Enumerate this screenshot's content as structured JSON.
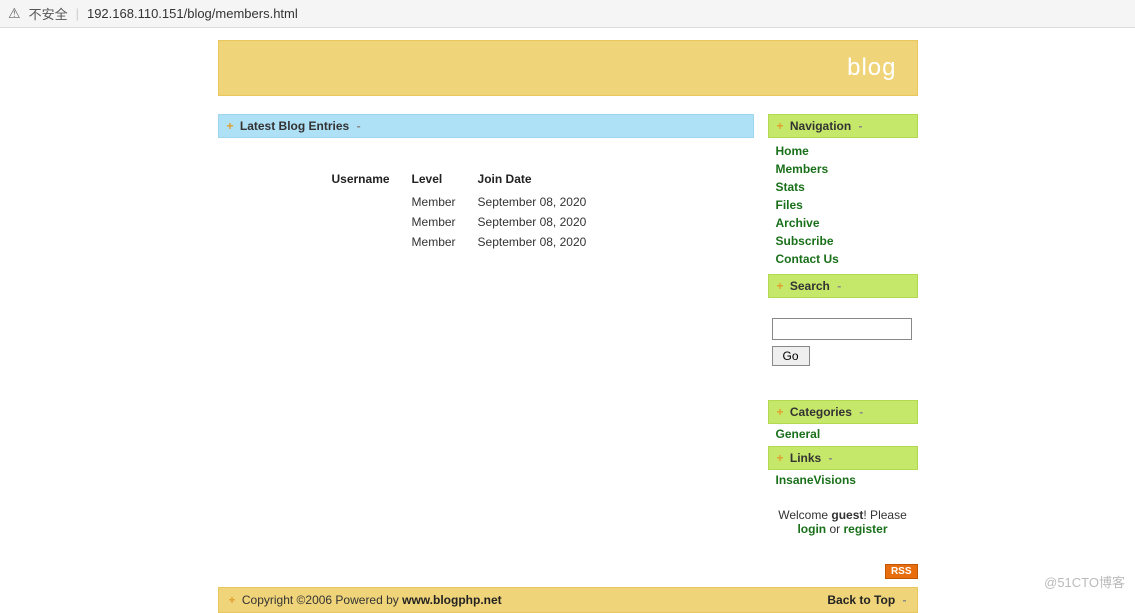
{
  "browser": {
    "insecure_label": "不安全",
    "url": "192.168.110.151/blog/members.html"
  },
  "header": {
    "site_title": "blog"
  },
  "main": {
    "section_title": "Latest Blog Entries",
    "table": {
      "headers": {
        "username": "Username",
        "level": "Level",
        "join_date": "Join Date"
      },
      "rows": [
        {
          "username": "",
          "level": "Member",
          "join_date": "September 08, 2020"
        },
        {
          "username": "",
          "level": "Member",
          "join_date": "September 08, 2020"
        },
        {
          "username": "",
          "level": "Member",
          "join_date": "September 08, 2020"
        }
      ]
    }
  },
  "sidebar": {
    "nav_title": "Navigation",
    "nav_items": [
      "Home",
      "Members",
      "Stats",
      "Files",
      "Archive",
      "Subscribe",
      "Contact Us"
    ],
    "search_title": "Search",
    "search_button": "Go",
    "categories_title": "Categories",
    "categories": [
      "General"
    ],
    "links_title": "Links",
    "links": [
      "InsaneVisions"
    ],
    "welcome_pre": "Welcome ",
    "welcome_guest": "guest",
    "welcome_post": "! Please",
    "login": "login",
    "or": " or ",
    "register": "register",
    "rss": "RSS"
  },
  "footer": {
    "plus": "+",
    "copyright_pre": " Copyright ©2006 Powered by ",
    "copyright_link": "www.blogphp.net",
    "back_to_top": "Back to Top",
    "minus": "-"
  },
  "watermark": "@51CTO博客"
}
